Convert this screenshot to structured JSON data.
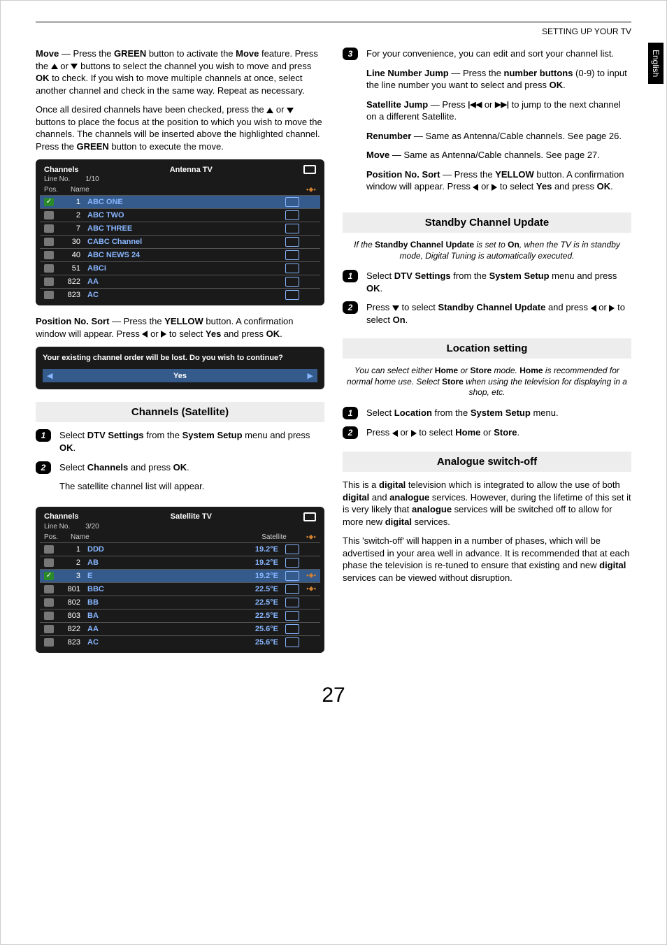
{
  "header": {
    "title": "SETTING UP YOUR TV",
    "side_tab": "English"
  },
  "left": {
    "p1_a": "Move",
    "p1_b": " — Press the ",
    "p1_c": "GREEN",
    "p1_d": " button to activate the ",
    "p1_e": "Move",
    "p1_f": " feature. Press the ",
    "p1_g": " or ",
    "p1_h": " buttons to select the channel you wish to move and press ",
    "p1_i": "OK",
    "p1_j": " to check. If you wish to move multiple channels at once, select another channel and check in the same way. Repeat as necessary.",
    "p2_a": "Once all desired channels have been checked, press the ",
    "p2_b": " or ",
    "p2_c": " buttons to place the focus at the position to which you wish to move the channels. The channels will be inserted above the highlighted channel. Press the ",
    "p2_d": "GREEN",
    "p2_e": " button to execute the move.",
    "pos_sort_label": "Position No. Sort",
    "pos_sort_a": " — Press the ",
    "pos_sort_b": "YELLOW",
    "pos_sort_c": " button. A confirmation window will appear. Press ",
    "pos_sort_d": " or ",
    "pos_sort_e": " to select ",
    "pos_sort_f": "Yes",
    "pos_sort_g": " and press ",
    "pos_sort_h": "OK",
    "pos_sort_i": ".",
    "dialog_msg": "Your existing channel order will be lost. Do you wish to continue?",
    "dialog_yes": "Yes",
    "sat_section_title": "Channels (Satellite)",
    "sat_step1_a": "Select ",
    "sat_step1_b": "DTV Settings",
    "sat_step1_c": " from the ",
    "sat_step1_d": "System Setup",
    "sat_step1_e": " menu and press ",
    "sat_step1_f": "OK",
    "sat_step1_g": ".",
    "sat_step2_a": "Select ",
    "sat_step2_b": "Channels",
    "sat_step2_c": " and press ",
    "sat_step2_d": "OK",
    "sat_step2_e": ".",
    "sat_p": "The  satellite channel list will appear."
  },
  "tv1": {
    "title": "Channels",
    "mode": "Antenna TV",
    "line_label": "Line No.",
    "line_val": "1/10",
    "col_pos": "Pos.",
    "col_name": "Name",
    "rows": [
      {
        "pos": "1",
        "name": "ABC ONE",
        "sel": true
      },
      {
        "pos": "2",
        "name": "ABC TWO"
      },
      {
        "pos": "7",
        "name": "ABC THREE"
      },
      {
        "pos": "30",
        "name": "CABC Channel"
      },
      {
        "pos": "40",
        "name": "ABC NEWS 24"
      },
      {
        "pos": "51",
        "name": "ABCi"
      },
      {
        "pos": "822",
        "name": "AA"
      },
      {
        "pos": "823",
        "name": "AC"
      }
    ]
  },
  "tv2": {
    "title": "Channels",
    "mode": "Satellite TV",
    "line_label": "Line No.",
    "line_val": "3/20",
    "col_pos": "Pos.",
    "col_name": "Name",
    "col_sat": "Satellite",
    "rows": [
      {
        "pos": "1",
        "name": "DDD",
        "sat": "19.2°E"
      },
      {
        "pos": "2",
        "name": "AB",
        "sat": "19.2°E"
      },
      {
        "pos": "3",
        "name": "E",
        "sat": "19.2°E",
        "sel": true,
        "dot": true
      },
      {
        "pos": "801",
        "name": "BBC",
        "sat": "22.5°E",
        "dot": true
      },
      {
        "pos": "802",
        "name": "BB",
        "sat": "22.5°E"
      },
      {
        "pos": "803",
        "name": "BA",
        "sat": "22.5°E"
      },
      {
        "pos": "822",
        "name": "AA",
        "sat": "25.6°E"
      },
      {
        "pos": "823",
        "name": "AC",
        "sat": "25.6°E"
      }
    ]
  },
  "right": {
    "step3_a": "For your convenience, you can edit and sort your channel list.",
    "lnj_a": "Line Number Jump",
    "lnj_b": " — Press the ",
    "lnj_c": "number buttons",
    "lnj_d": " (0-9) to input the line number you want to select and press ",
    "lnj_e": "OK",
    "lnj_f": ".",
    "satj_a": "Satellite Jump",
    "satj_b": " — Press ",
    "satj_c": " or ",
    "satj_d": " to jump to the next channel on a different Satellite.",
    "renum_a": "Renumber",
    "renum_b": " — Same as Antenna/Cable channels. See page 26.",
    "move_a": "Move",
    "move_b": " — Same as Antenna/Cable channels. See page 27.",
    "pns_a": "Position No. Sort",
    "pns_b": " — Press the ",
    "pns_c": "YELLOW",
    "pns_d": " button. A confirmation window will appear. Press ",
    "pns_e": " or ",
    "pns_f": " to select ",
    "pns_g": "Yes",
    "pns_h": " and press ",
    "pns_i": "OK",
    "pns_j": ".",
    "standby_title": "Standby Channel Update",
    "standby_sub_a": "If the ",
    "standby_sub_b": "Standby Channel Update",
    "standby_sub_c": " is set to ",
    "standby_sub_d": "On",
    "standby_sub_e": ", when the TV is in standby mode, Digital Tuning is automatically executed.",
    "standby_s1_a": "Select ",
    "standby_s1_b": "DTV Settings",
    "standby_s1_c": " from the ",
    "standby_s1_d": "System Setup",
    "standby_s1_e": " menu and press ",
    "standby_s1_f": "OK",
    "standby_s1_g": ".",
    "standby_s2_a": "Press ",
    "standby_s2_b": " to select ",
    "standby_s2_c": "Standby Channel Update",
    "standby_s2_d": " and press ",
    "standby_s2_e": " or ",
    "standby_s2_f": " to select ",
    "standby_s2_g": "On",
    "standby_s2_h": ".",
    "loc_title": "Location setting",
    "loc_sub_a": "You can select either ",
    "loc_sub_b": "Home",
    "loc_sub_c": " or ",
    "loc_sub_d": "Store",
    "loc_sub_e": " mode. ",
    "loc_sub_f": "Home",
    "loc_sub_g": " is recommended for normal home use. Select ",
    "loc_sub_h": "Store",
    "loc_sub_i": " when using the television for displaying in a shop, etc.",
    "loc_s1_a": "Select ",
    "loc_s1_b": "Location",
    "loc_s1_c": " from the ",
    "loc_s1_d": "System Setup",
    "loc_s1_e": " menu.",
    "loc_s2_a": "Press ",
    "loc_s2_b": " or ",
    "loc_s2_c": " to select ",
    "loc_s2_d": "Home",
    "loc_s2_e": " or ",
    "loc_s2_f": "Store",
    "loc_s2_g": ".",
    "ana_title": "Analogue switch-off",
    "ana_p1_a": "This is a ",
    "ana_p1_b": "digital",
    "ana_p1_c": " television which is integrated to allow the use of both ",
    "ana_p1_d": "digital",
    "ana_p1_e": " and ",
    "ana_p1_f": "analogue",
    "ana_p1_g": " services. However, during the lifetime of this set it is very likely that ",
    "ana_p1_h": "analogue",
    "ana_p1_i": " services will be switched off to allow for more new ",
    "ana_p1_j": "digital",
    "ana_p1_k": " services.",
    "ana_p2_a": "This 'switch-off' will happen in a number of phases, which will be advertised in your area well in advance. It is recommended that at each phase the television is re-tuned to ensure that existing and new ",
    "ana_p2_b": "digital",
    "ana_p2_c": " services can be viewed without disruption."
  },
  "page_number": "27"
}
